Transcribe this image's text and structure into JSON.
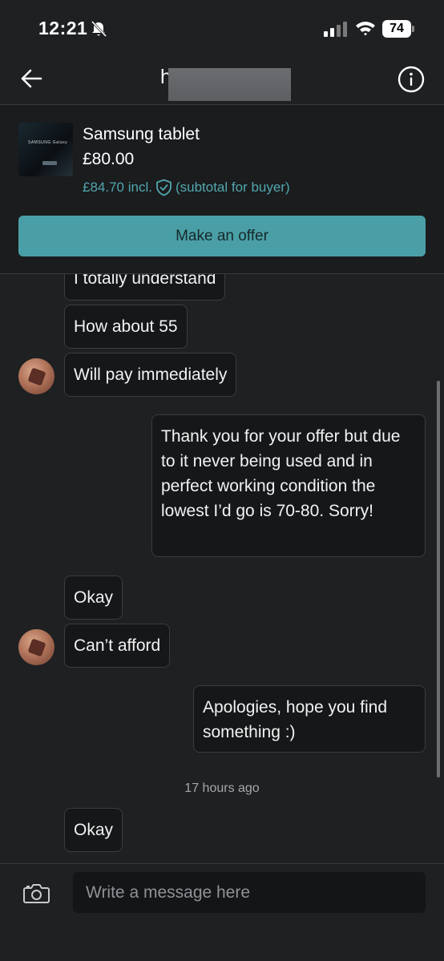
{
  "status_bar": {
    "time": "12:21",
    "battery": "74"
  },
  "header": {
    "chat_name": "h"
  },
  "item": {
    "title": "Samsung tablet",
    "price": "£80.00",
    "price_incl": "£84.70 incl.",
    "subtotal_note": "(subtotal for buyer)",
    "thumb_label": "SAMSUNG Galaxy",
    "offer_button": "Make an offer"
  },
  "messages": [
    {
      "id": "m1",
      "side": "received",
      "text": "I totally understand"
    },
    {
      "id": "m2",
      "side": "received",
      "text": "How about 55"
    },
    {
      "id": "m3",
      "side": "received",
      "text": "Will pay immediately"
    },
    {
      "id": "m4",
      "side": "sent",
      "text": "Thank you for your offer but due to it never being used and in perfect working condition the lowest I’d go is 70-80. Sorry!"
    },
    {
      "id": "m5",
      "side": "received",
      "text": "Okay"
    },
    {
      "id": "m6",
      "side": "received",
      "text": "Can’t afford"
    },
    {
      "id": "m7",
      "side": "sent",
      "text": "Apologies, hope you find something :)"
    },
    {
      "id": "m8",
      "side": "received",
      "text": "Okay"
    }
  ],
  "timestamp": "17 hours ago",
  "composer": {
    "placeholder": "Write a message here"
  },
  "colors": {
    "accent": "#4a9fa6",
    "price_incl": "#52a7ae",
    "background": "#1e2022",
    "bubble": "#151719"
  }
}
